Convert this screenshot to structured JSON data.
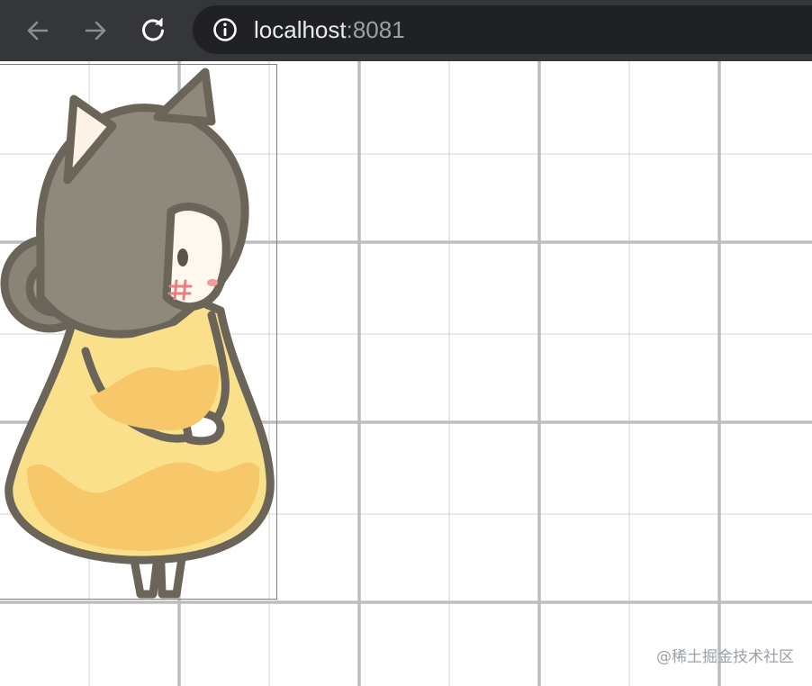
{
  "browser": {
    "url_host": "localhost",
    "url_port": ":8081",
    "back_icon": "arrow-left-icon",
    "forward_icon": "arrow-right-icon",
    "reload_icon": "reload-icon",
    "info_icon": "info-icon"
  },
  "canvas": {
    "character": "cat-eared-girl-illustration"
  },
  "watermark": {
    "text": "@稀土掘金技术社区"
  },
  "colors": {
    "toolbar_bg": "#35363a",
    "omnibox_bg": "#202124",
    "selection_border": "#4a86e8",
    "grid_line": "#bdbdbd"
  }
}
